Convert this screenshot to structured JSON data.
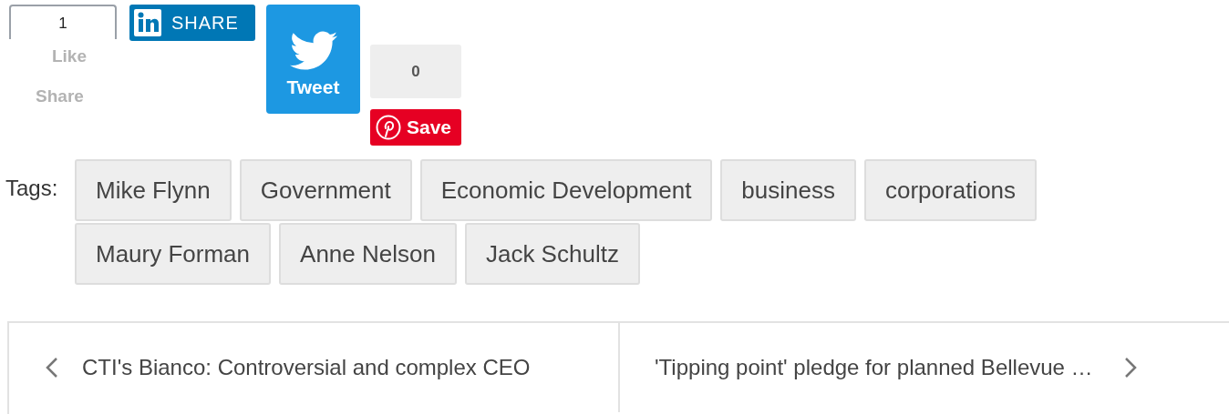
{
  "social": {
    "facebook": {
      "count": "1",
      "like": "Like",
      "share": "Share"
    },
    "linkedin": {
      "label": "SHARE"
    },
    "twitter": {
      "label": "Tweet"
    },
    "pinterest": {
      "count": "0",
      "label": "Save"
    }
  },
  "tags": {
    "label": "Tags:",
    "items": [
      "Mike Flynn",
      "Government",
      "Economic Development",
      "business",
      "corporations",
      "Maury Forman",
      "Anne Nelson",
      "Jack Schultz"
    ]
  },
  "post_nav": {
    "previous": "CTI's Bianco: Controversial and complex CEO",
    "next": "'Tipping point' pledge for planned Bellevue …"
  }
}
